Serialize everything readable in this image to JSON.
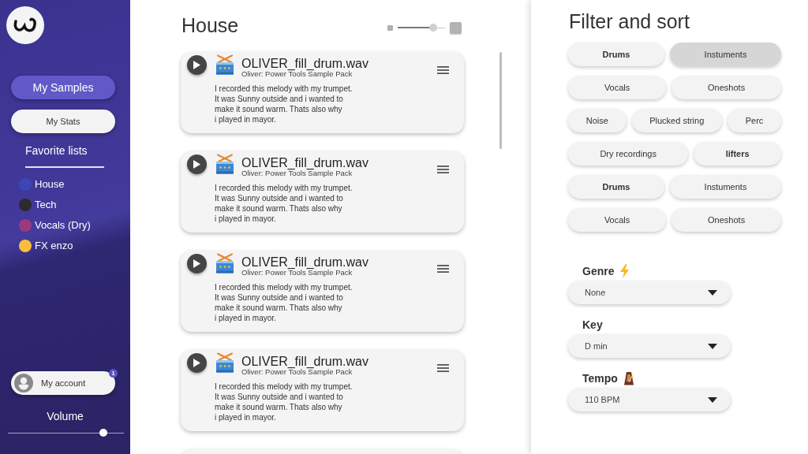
{
  "sidebar": {
    "nav": [
      {
        "label": "My Samples",
        "selected": true
      },
      {
        "label": "My Stats",
        "selected": false
      }
    ],
    "favorites_title": "Favorite lists",
    "favorites": [
      {
        "label": "House",
        "color": "#3d46b6"
      },
      {
        "label": "Tech",
        "color": "#2b2b2b"
      },
      {
        "label": "Vocals (Dry)",
        "color": "#9a3b7f"
      },
      {
        "label": "FX enzo",
        "color": "#fbbd3b"
      }
    ],
    "account": {
      "label": "My account",
      "badge": "1"
    },
    "volume": {
      "label": "Volume",
      "level": 0.82
    }
  },
  "main": {
    "title": "House",
    "size_slider": {
      "level": 0.75
    },
    "cards": [
      {
        "kind": "sample",
        "title": "OLIVER_fill_drum.wav",
        "pack": "Oliver: Power Tools Sample Pack",
        "description_lines": [
          "I recorded this melody with my trumpet.",
          "It was Sunny outside and i wanted to",
          "make it sound warm. Thats also why",
          "i played in mayor."
        ]
      },
      {
        "kind": "sample",
        "title": "OLIVER_fill_drum.wav",
        "pack": "Oliver: Power Tools Sample Pack",
        "description_lines": [
          "I recorded this melody with my trumpet.",
          "It was Sunny outside and i wanted to",
          "make it sound warm. Thats also why",
          "i played in mayor."
        ]
      },
      {
        "kind": "sample",
        "title": "OLIVER_fill_drum.wav",
        "pack": "Oliver: Power Tools Sample Pack",
        "description_lines": [
          "I recorded this melody with my trumpet.",
          "It was Sunny outside and i wanted to",
          "make it sound warm. Thats also why",
          "i played in mayor."
        ]
      },
      {
        "kind": "sample",
        "title": "OLIVER_fill_drum.wav",
        "pack": "Oliver: Power Tools Sample Pack",
        "description_lines": [
          "I recorded this melody with my trumpet.",
          "It was Sunny outside and i wanted to",
          "make it sound warm. Thats also why",
          "i played in mayor."
        ]
      },
      {
        "kind": "peek"
      }
    ]
  },
  "filter": {
    "title": "Filter and sort",
    "chip_rows": [
      [
        {
          "label": "Drums",
          "selected": false,
          "emphasized": true
        },
        {
          "label": "Instuments",
          "selected": true,
          "emphasized": false
        }
      ],
      [
        {
          "label": "Vocals",
          "selected": false,
          "emphasized": false
        },
        {
          "label": "Oneshots",
          "selected": false,
          "emphasized": false
        }
      ],
      [
        {
          "label": "Noise",
          "selected": false,
          "emphasized": false
        },
        {
          "label": "Plucked string",
          "selected": false,
          "emphasized": false
        },
        {
          "label": "Perc",
          "selected": false,
          "emphasized": false
        }
      ],
      [
        {
          "label": "Dry recordings",
          "selected": false,
          "emphasized": false
        },
        {
          "label": "lifters",
          "selected": false,
          "emphasized": true
        }
      ],
      [
        {
          "label": "Drums",
          "selected": false,
          "emphasized": true
        },
        {
          "label": "Instuments",
          "selected": false,
          "emphasized": false
        }
      ],
      [
        {
          "label": "Vocals",
          "selected": false,
          "emphasized": false
        },
        {
          "label": "Oneshots",
          "selected": false,
          "emphasized": false
        }
      ]
    ],
    "selects": [
      {
        "kind": "genre",
        "label": "Genre",
        "value": "None"
      },
      {
        "kind": "key",
        "label": "Key",
        "value": "D min"
      },
      {
        "kind": "tempo",
        "label": "Tempo",
        "value": "110 BPM"
      }
    ]
  }
}
